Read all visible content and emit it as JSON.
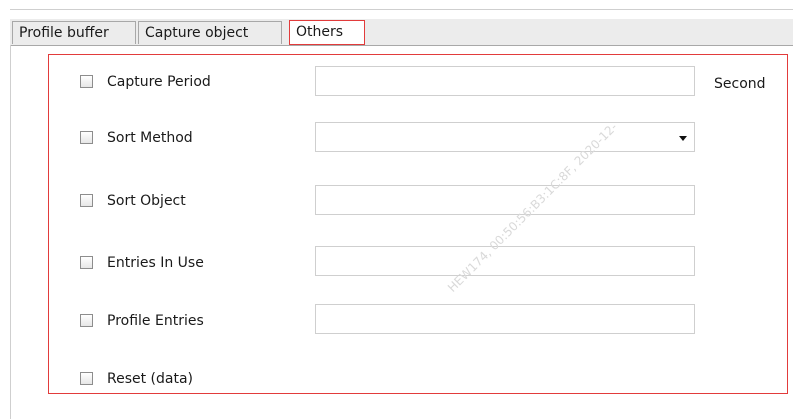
{
  "tabs": [
    {
      "label": "Profile buffer"
    },
    {
      "label": "Capture object"
    },
    {
      "label": "Others",
      "active": true
    }
  ],
  "form": {
    "capture_period": {
      "label": "Capture Period",
      "value": "",
      "unit": "Second",
      "checked": false
    },
    "sort_method": {
      "label": "Sort Method",
      "selected": "",
      "checked": false
    },
    "sort_object": {
      "label": "Sort Object",
      "value": "",
      "checked": false
    },
    "entries_in_use": {
      "label": "Entries In Use",
      "value": "",
      "checked": false
    },
    "profile_entries": {
      "label": "Profile Entries",
      "value": "",
      "checked": false
    },
    "reset_data": {
      "label": "Reset (data)",
      "checked": false
    }
  },
  "watermark": {
    "text": "HEW174, 00:50:56:B3:1C:8F, 2020-12-"
  },
  "colors": {
    "highlight": "#e23b3b",
    "tab_bg": "#ececec",
    "field_border": "#cfcfcf"
  }
}
